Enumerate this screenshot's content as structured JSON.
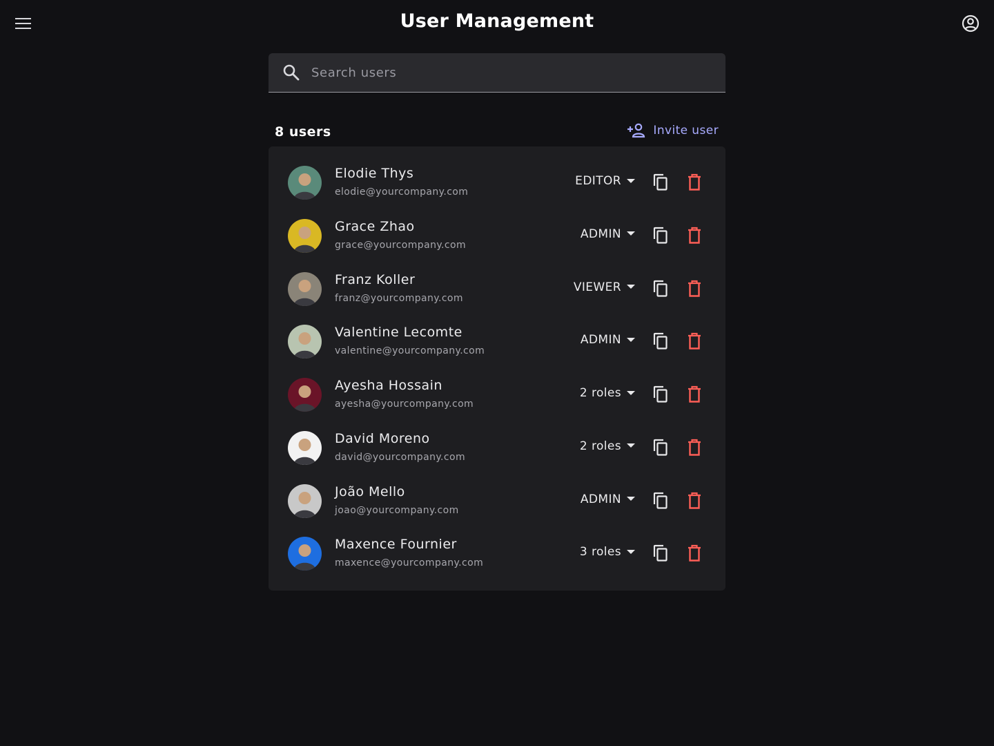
{
  "header": {
    "title": "User Management"
  },
  "search": {
    "placeholder": "Search users"
  },
  "list": {
    "count_label": "8 users",
    "invite_label": "Invite user"
  },
  "colors": {
    "background": "#111114",
    "card": "#1e1e21",
    "accent": "#a8abff",
    "delete": "#ff5f57"
  },
  "users": [
    {
      "name": "Elodie Thys",
      "email": "elodie@yourcompany.com",
      "role": "EDITOR",
      "avatar_color": "#5a8a7a"
    },
    {
      "name": "Grace Zhao",
      "email": "grace@yourcompany.com",
      "role": "ADMIN",
      "avatar_color": "#d9b824"
    },
    {
      "name": "Franz Koller",
      "email": "franz@yourcompany.com",
      "role": "VIEWER",
      "avatar_color": "#8a8478"
    },
    {
      "name": "Valentine Lecomte",
      "email": "valentine@yourcompany.com",
      "role": "ADMIN",
      "avatar_color": "#b8c4b0"
    },
    {
      "name": "Ayesha Hossain",
      "email": "ayesha@yourcompany.com",
      "role": "2 roles",
      "avatar_color": "#6a1428"
    },
    {
      "name": "David Moreno",
      "email": "david@yourcompany.com",
      "role": "2 roles",
      "avatar_color": "#f2f2f2"
    },
    {
      "name": "João Mello",
      "email": "joao@yourcompany.com",
      "role": "ADMIN",
      "avatar_color": "#c8c8c8"
    },
    {
      "name": "Maxence Fournier",
      "email": "maxence@yourcompany.com",
      "role": "3 roles",
      "avatar_color": "#1e6ee0"
    }
  ]
}
